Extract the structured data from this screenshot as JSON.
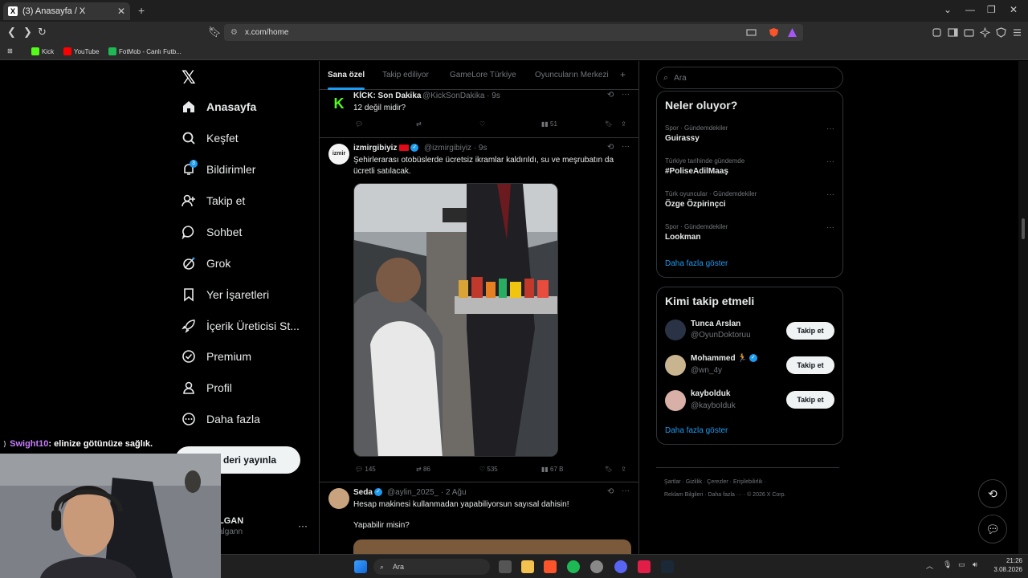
{
  "browser": {
    "tab_title": "(3) Anasayfa / X",
    "url": "x.com/home",
    "bookmarks": [
      "Kick",
      "YouTube",
      "FotMob - Canlı Futb..."
    ]
  },
  "nav": {
    "items": [
      {
        "label": "Anasayfa",
        "icon": "home-icon"
      },
      {
        "label": "Keşfet",
        "icon": "search-icon"
      },
      {
        "label": "Bildirimler",
        "icon": "bell-icon",
        "badge": "3"
      },
      {
        "label": "Takip et",
        "icon": "person-add-icon"
      },
      {
        "label": "Sohbet",
        "icon": "chat-icon"
      },
      {
        "label": "Grok",
        "icon": "grok-icon"
      },
      {
        "label": "Yer İşaretleri",
        "icon": "bookmark-icon"
      },
      {
        "label": "İçerik Üreticisi St...",
        "icon": "rocket-icon"
      },
      {
        "label": "Premium",
        "icon": "premium-icon"
      },
      {
        "label": "Profil",
        "icon": "profile-icon"
      },
      {
        "label": "Daha fazla",
        "icon": "more-circle-icon"
      }
    ],
    "post_button": "deri yayınla",
    "profile_name": "LGAN",
    "profile_handle": "algann"
  },
  "feed": {
    "tabs": [
      "Sana özel",
      "Takip ediliyor",
      "GameLore Türkiye",
      "Oyuncuların Merkezi"
    ],
    "tweets": [
      {
        "name": "KİCK: Son Dakika",
        "handle": "@KickSonDakika · 9s",
        "text": "12 değil midir?",
        "views": "51"
      },
      {
        "name": "izmirgibiyiz",
        "handle": "@izmirgibiyiz · 9s",
        "text": "Şehirlerarası otobüslerde ücretsiz ikramlar kaldırıldı, su ve meşrubatın da ücretli satılacak.",
        "replies": "145",
        "retweets": "86",
        "likes": "535",
        "views": "67 B"
      },
      {
        "name": "Seda",
        "handle": "@aylin_2025_ · 2 Ağu",
        "text": "Hesap makinesi kullanmadan yapabiliyorsun sayısal dahisin!",
        "text2": "Yapabilir misin?"
      }
    ]
  },
  "sidebar": {
    "search_placeholder": "Ara",
    "trends_title": "Neler oluyor?",
    "trends": [
      {
        "meta": "Spor · Gündemdekiler",
        "name": "Guirassy"
      },
      {
        "meta": "Türkiye tarihinde gündemde",
        "name": "#PoliseAdilMaaş"
      },
      {
        "meta": "Türk oyuncular · Gündemdekiler",
        "name": "Özge Özpirinçci"
      },
      {
        "meta": "Spor · Gündemdekiler",
        "name": "Lookman"
      }
    ],
    "trends_more": "Daha fazla göster",
    "who_title": "Kimi takip etmeli",
    "who": [
      {
        "name": "Tunca Arslan",
        "handle": "@OyunDoktoruu"
      },
      {
        "name": "Mohammed 🏃",
        "handle": "@wn_4y"
      },
      {
        "name": "kaybolduk",
        "handle": "@kayboIduk"
      }
    ],
    "follow_label": "Takip et",
    "who_more": "Daha fazla göster",
    "footer1": "Şartlar  ·  Gizlilik  ·  Çerezler  ·  Erişilebilirlik  ·",
    "footer2": "Reklam Bilgileri  ·  Daha fazla ···  ·  © 2026 X Corp."
  },
  "stream": {
    "chat_user": "Swight10",
    "chat_message": ": elinize götünüze sağlık."
  },
  "taskbar": {
    "search": "Ara",
    "time": "21:26",
    "date": "3.08.2026"
  },
  "colors": {
    "accent": "#1d9bf0",
    "background": "#000000",
    "border": "#2f3336"
  }
}
